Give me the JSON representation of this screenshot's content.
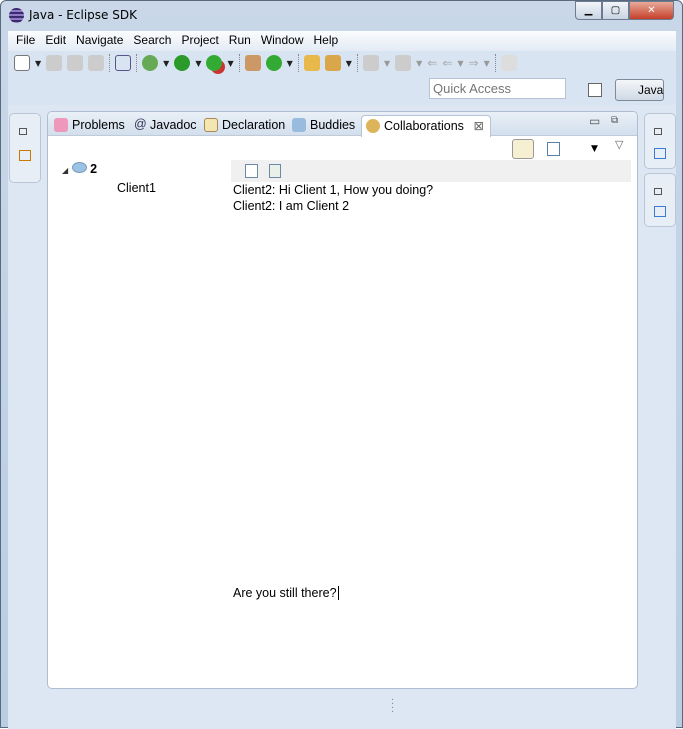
{
  "window": {
    "title": "Java - Eclipse SDK",
    "buttons": [
      "minimize",
      "maximize",
      "close"
    ]
  },
  "menu": [
    {
      "u": "F",
      "rest": "ile"
    },
    {
      "u": "E",
      "rest": "dit"
    },
    {
      "u": "N",
      "rest": "avigate"
    },
    {
      "u": "",
      "pre": "Se",
      "u2": "a",
      "rest": "rch"
    },
    {
      "u": "P",
      "rest": "roject"
    },
    {
      "u": "R",
      "rest": "un"
    },
    {
      "u": "W",
      "rest": "indow"
    },
    {
      "u": "H",
      "rest": "elp"
    }
  ],
  "menu_labels": [
    "File",
    "Edit",
    "Navigate",
    "Search",
    "Project",
    "Run",
    "Window",
    "Help"
  ],
  "quick_access": {
    "placeholder": "Quick Access"
  },
  "perspective": {
    "label": "Java"
  },
  "tabs": [
    {
      "label": "Problems",
      "icon": "problems-icon"
    },
    {
      "label": "Javadoc",
      "icon": "at-icon"
    },
    {
      "label": "Declaration",
      "icon": "declaration-icon"
    },
    {
      "label": "Buddies",
      "icon": "buddies-icon"
    },
    {
      "label": "Collaborations",
      "icon": "chat-icon",
      "active": true
    }
  ],
  "tree": {
    "root": "2",
    "child": "Client1"
  },
  "messages": [
    "Client2: Hi Client 1, How you doing?",
    "Client2: I am Client 2"
  ],
  "input": {
    "value": "Are you still there?"
  },
  "colors": {
    "background": "#dde7f3",
    "accent": "#3b7bd0"
  }
}
